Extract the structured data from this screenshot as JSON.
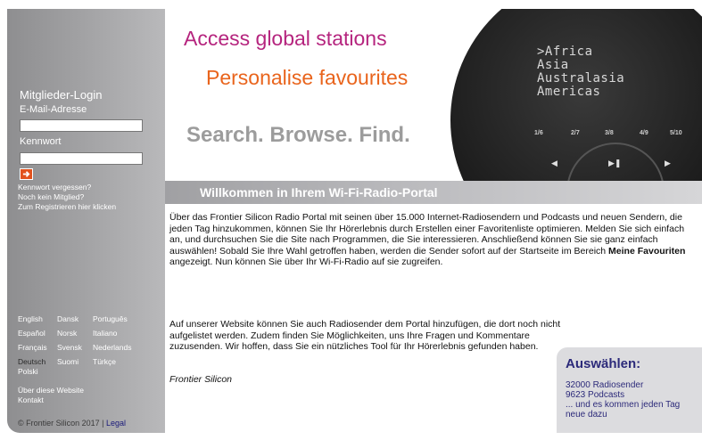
{
  "sidebar": {
    "login_title": "Mitglieder-Login",
    "email_label": "E-Mail-Adresse",
    "password_label": "Kennwort",
    "forgot_link": "Kennwort vergessen?",
    "no_member": "Noch kein Mitglied?",
    "register_link": "Zum Registrieren hier klicken",
    "languages": [
      [
        "English",
        "Dansk",
        "Português"
      ],
      [
        "Español",
        "Norsk",
        "Italiano"
      ],
      [
        "Français",
        "Svensk",
        "Nederlands"
      ],
      [
        "Deutsch",
        "Suomi",
        "Türkçe"
      ]
    ],
    "language_polski": "Polski",
    "active_language": "Deutsch",
    "about_link": "Über diese Website",
    "contact_link": "Kontakt",
    "copyright": "© Frontier Silicon 2017 | ",
    "legal_link": "Legal"
  },
  "banner": {
    "tagline_1": "Access global stations",
    "tagline_2": "Personalise favourites",
    "tagline_3": "Search. Browse. Find.",
    "regions": [
      ">Africa",
      " Asia",
      " Australasia",
      " Americas"
    ],
    "presets": [
      "1/6",
      "2/7",
      "3/8",
      "4/9",
      "5/10"
    ]
  },
  "welcome": {
    "title": "Willkommen in Ihrem Wi-Fi-Radio-Portal"
  },
  "main": {
    "intro_before": "Über das Frontier Silicon Radio Portal mit seinen über 15.000 Internet-Radiosendern und Podcasts und neuen Sendern, die jeden Tag hinzukommen, können Sie Ihr Hörerlebnis durch Erstellen einer Favoritenliste optimieren. Melden Sie sich einfach an, und durchsuchen Sie die Site nach Programmen, die Sie interessieren. Anschließend können Sie sie ganz einfach auswählen! Sobald Sie Ihre Wahl getroffen haben, werden die Sender sofort auf der Startseite im Bereich ",
    "intro_bold": "Meine Favouriten",
    "intro_after": " angezeigt. Nun können Sie über Ihr Wi-Fi-Radio auf sie zugreifen.",
    "intro_2": "Auf unserer Website können Sie auch Radiosender dem Portal hinzufügen, die dort noch nicht aufgelistet werden. Zudem finden Sie Möglichkeiten, uns Ihre Fragen und Kommentare zuzusenden. Wir hoffen, dass Sie ein nützliches Tool für Ihr Hörerlebnis gefunden haben.",
    "signature": "Frontier Silicon"
  },
  "select": {
    "title": "Auswählen:",
    "lines": [
      "32000 Radiosender",
      "9623 Podcasts",
      "... und es kommen jeden Tag",
      "neue dazu"
    ]
  },
  "colors": {
    "tagline_1": "#b5247e",
    "tagline_2": "#e9641c",
    "select_text": "#2c2a7a",
    "login_button": "#e2521d"
  },
  "icons": {
    "login_button": "arrow-right-icon",
    "controls": [
      "previous-icon",
      "play-pause-icon",
      "next-icon"
    ]
  }
}
